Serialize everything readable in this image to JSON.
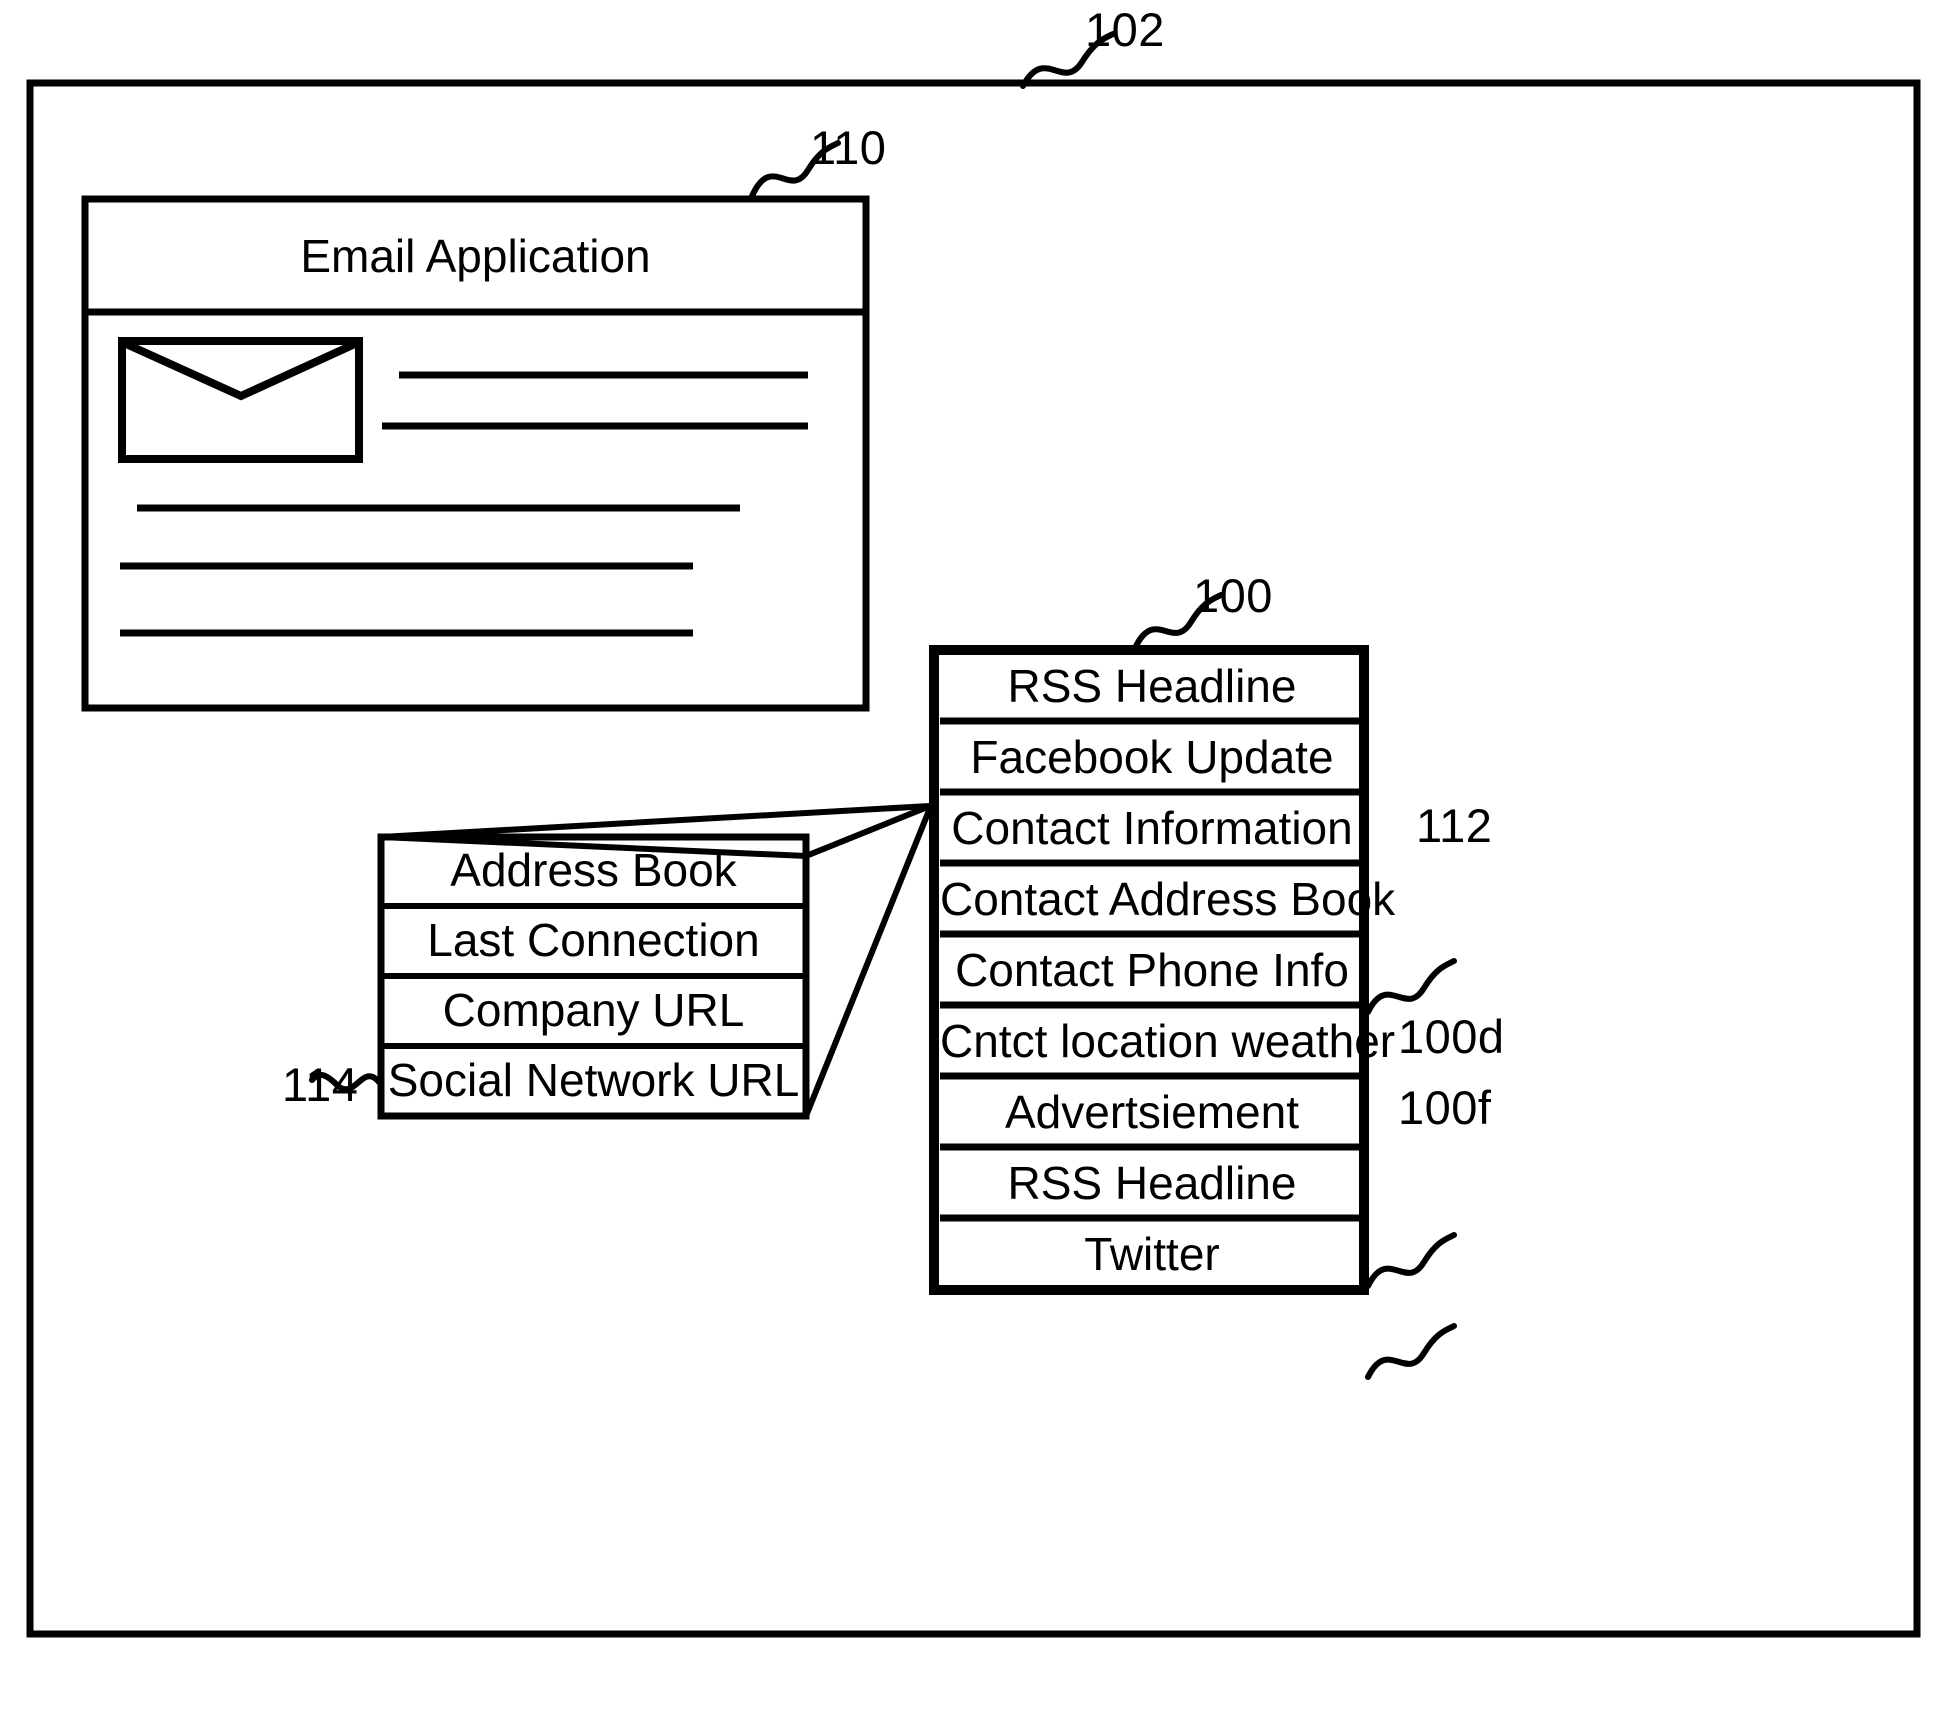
{
  "figure": {
    "outer_frame_ref": "102",
    "email_window": {
      "ref": "110",
      "title": "Email Application",
      "icon": "envelope-icon",
      "body_line_count": 5
    },
    "address_book": {
      "ref": "114",
      "rows": [
        "Address Book",
        "Last Connection",
        "Company URL",
        "Social Network URL"
      ]
    },
    "feed_list": {
      "ref": "100",
      "rows": [
        "RSS Headline",
        "Facebook Update",
        "Contact Information",
        "Contact Address Book",
        "Contact Phone Info",
        "Cntct location weather",
        "Advertsiement",
        "RSS Headline",
        "Twitter"
      ],
      "row_refs": {
        "contact_information": "112",
        "cntct_location_weather": "100d",
        "advertsiement": "100f"
      }
    },
    "colors": {
      "ink": "#000000",
      "paper": "#ffffff"
    }
  }
}
